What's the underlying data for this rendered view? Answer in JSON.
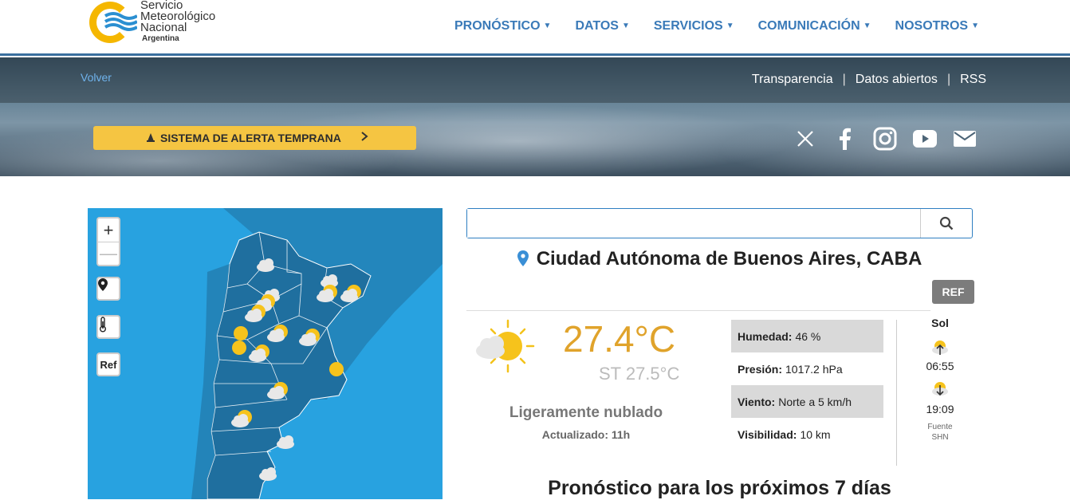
{
  "logo": {
    "line1": "Servicio",
    "line2": "Meteorológico",
    "line3": "Nacional",
    "sub": "Argentina"
  },
  "nav": [
    {
      "label": "PRONÓSTICO"
    },
    {
      "label": "DATOS"
    },
    {
      "label": "SERVICIOS"
    },
    {
      "label": "COMUNICACIÓN"
    },
    {
      "label": "NOSOTROS"
    }
  ],
  "banner": {
    "back_label": "Volver",
    "links": [
      "Transparencia",
      "Datos abiertos",
      "RSS"
    ],
    "alert_label": "SISTEMA DE ALERTA TEMPRANA",
    "social_icons": [
      "x-icon",
      "facebook-icon",
      "instagram-icon",
      "youtube-icon",
      "mail-icon"
    ]
  },
  "map": {
    "zoom_in": "+",
    "zoom_out": "—",
    "ref_label": "Ref"
  },
  "search": {
    "placeholder": "",
    "value": ""
  },
  "location": {
    "city": "Ciudad Autónoma de Buenos Aires, CABA",
    "ref_button": "REF"
  },
  "current": {
    "temperature": "27.4°C",
    "feels_like": "ST 27.5°C",
    "description": "Ligeramente nublado",
    "updated": "Actualizado: 11h",
    "stats": [
      {
        "label": "Humedad:",
        "value": "46 %"
      },
      {
        "label": "Presión:",
        "value": "1017.2 hPa"
      },
      {
        "label": "Viento:",
        "value": "Norte a 5 km/h"
      },
      {
        "label": "Visibilidad:",
        "value": "10 km"
      }
    ]
  },
  "sun": {
    "title": "Sol",
    "sunrise": "06:55",
    "sunset": "19:09",
    "source_label": "Fuente",
    "source": "SHN"
  },
  "forecast": {
    "title": "Pronóstico para los próximos 7 días"
  },
  "colors": {
    "nav_blue": "#3a7ab8",
    "alert_yellow": "#f5c542",
    "temp_orange": "#e0a32b",
    "map_sea": "#28a2e0",
    "map_land": "#1f6f9f"
  }
}
